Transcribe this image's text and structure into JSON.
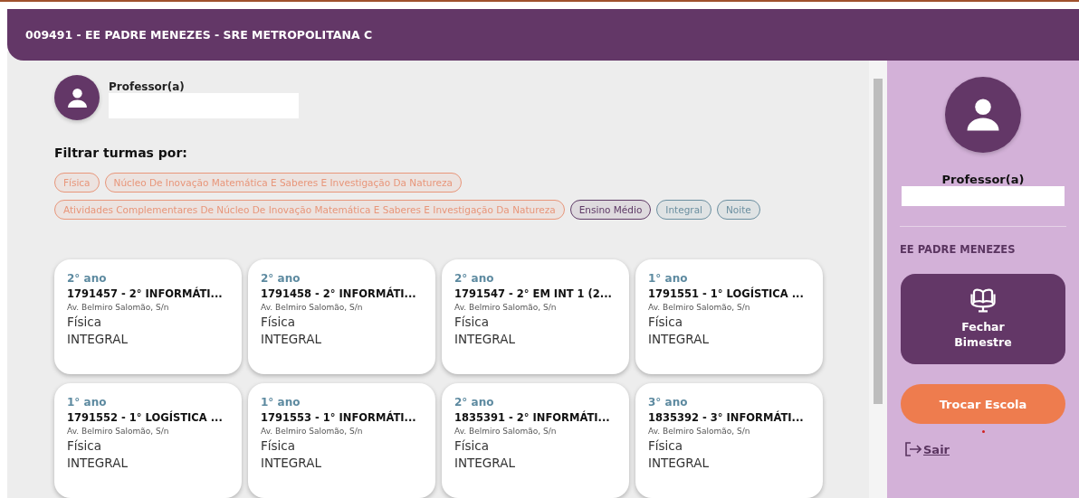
{
  "header": {
    "title": "009491 - EE PADRE MENEZES - SRE METROPOLITANA C"
  },
  "profile": {
    "role": "Professor(a)"
  },
  "filters": {
    "title": "Filtrar turmas por:",
    "chips": [
      {
        "label": "Física",
        "color": "#e8967a"
      },
      {
        "label": "Núcleo De Inovação Matemática E Saberes E Investigação Da Natureza",
        "color": "#e8967a"
      },
      {
        "label": "Atividades Complementares De Núcleo De Inovação Matemática E Saberes E Investigação Da Natureza",
        "color": "#e8967a"
      },
      {
        "label": "Ensino Médio",
        "color": "#5e3a66"
      },
      {
        "label": "Integral",
        "color": "#6b8fa0"
      },
      {
        "label": "Noite",
        "color": "#6b8fa0"
      }
    ]
  },
  "classes": [
    {
      "year": "2° ano",
      "name": "1791457 - 2° INFORMÁTI...",
      "address": "Av. Belmiro Salomão, S/n",
      "subject": "Física",
      "shift": "INTEGRAL"
    },
    {
      "year": "2° ano",
      "name": "1791458 - 2° INFORMÁTI...",
      "address": "Av. Belmiro Salomão, S/n",
      "subject": "Física",
      "shift": "INTEGRAL"
    },
    {
      "year": "2° ano",
      "name": "1791547 - 2° EM INT 1 (2...",
      "address": "Av. Belmiro Salomão, S/n",
      "subject": "Física",
      "shift": "INTEGRAL"
    },
    {
      "year": "1° ano",
      "name": "1791551 - 1° LOGÍSTICA ...",
      "address": "Av. Belmiro Salomão, S/n",
      "subject": "Física",
      "shift": "INTEGRAL"
    },
    {
      "year": "1° ano",
      "name": "1791552 - 1° LOGÍSTICA ...",
      "address": "Av. Belmiro Salomão, S/n",
      "subject": "Física",
      "shift": "INTEGRAL"
    },
    {
      "year": "1° ano",
      "name": "1791553 - 1° INFORMÁTI...",
      "address": "Av. Belmiro Salomão, S/n",
      "subject": "Física",
      "shift": "INTEGRAL"
    },
    {
      "year": "2° ano",
      "name": "1835391 - 2° INFORMÁTI...",
      "address": "Av. Belmiro Salomão, S/n",
      "subject": "Física",
      "shift": "INTEGRAL"
    },
    {
      "year": "3° ano",
      "name": "1835392 - 3° INFORMÁTI...",
      "address": "Av. Belmiro Salomão, S/n",
      "subject": "Física",
      "shift": "INTEGRAL"
    }
  ],
  "sidebar": {
    "role": "Professor(a)",
    "school": "EE PADRE MENEZES",
    "close_button": "Fechar Bimestre",
    "switch_button": "Trocar Escola",
    "logout": "Sair"
  }
}
